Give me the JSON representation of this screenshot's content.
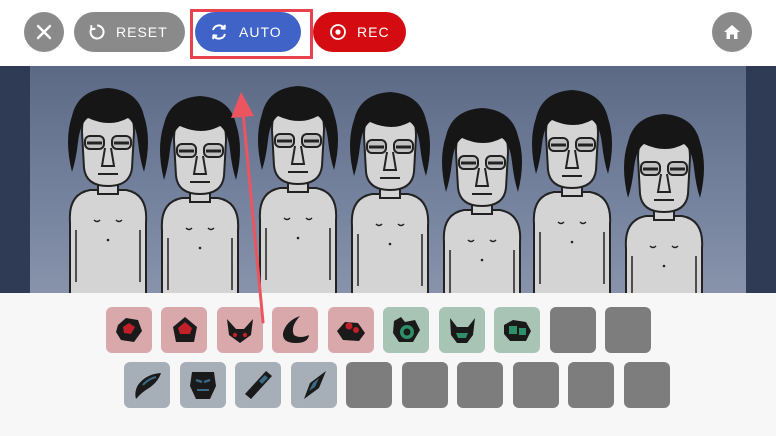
{
  "toolbar": {
    "close_icon": "close-icon",
    "reset_label": "RESET",
    "reset_icon": "reset-icon",
    "auto_label": "AUTO",
    "auto_icon": "refresh-icon",
    "rec_label": "REC",
    "rec_icon": "record-icon",
    "home_icon": "home-icon",
    "colors": {
      "gray_button": "#8a8a8a",
      "auto_button": "#3f63c6",
      "rec_button": "#d40c12",
      "highlight": "#e6434f"
    }
  },
  "stage": {
    "character_count": 7,
    "background": "#6f7d99"
  },
  "tray": {
    "row1": [
      {
        "kind": "beat",
        "icon": "beat-icon-1"
      },
      {
        "kind": "beat",
        "icon": "beat-icon-2"
      },
      {
        "kind": "beat",
        "icon": "beat-icon-3"
      },
      {
        "kind": "beat",
        "icon": "beat-icon-4"
      },
      {
        "kind": "beat",
        "icon": "beat-icon-5"
      },
      {
        "kind": "effect",
        "icon": "effect-icon-1"
      },
      {
        "kind": "effect",
        "icon": "effect-icon-2"
      },
      {
        "kind": "effect",
        "icon": "effect-icon-3"
      },
      {
        "kind": "empty"
      },
      {
        "kind": "empty"
      }
    ],
    "row2": [
      {
        "kind": "melody",
        "icon": "melody-icon-1"
      },
      {
        "kind": "melody",
        "icon": "melody-icon-2"
      },
      {
        "kind": "melody",
        "icon": "melody-icon-3"
      },
      {
        "kind": "melody",
        "icon": "melody-icon-4"
      },
      {
        "kind": "empty"
      },
      {
        "kind": "empty"
      },
      {
        "kind": "empty"
      },
      {
        "kind": "empty"
      },
      {
        "kind": "empty"
      },
      {
        "kind": "empty"
      }
    ]
  }
}
